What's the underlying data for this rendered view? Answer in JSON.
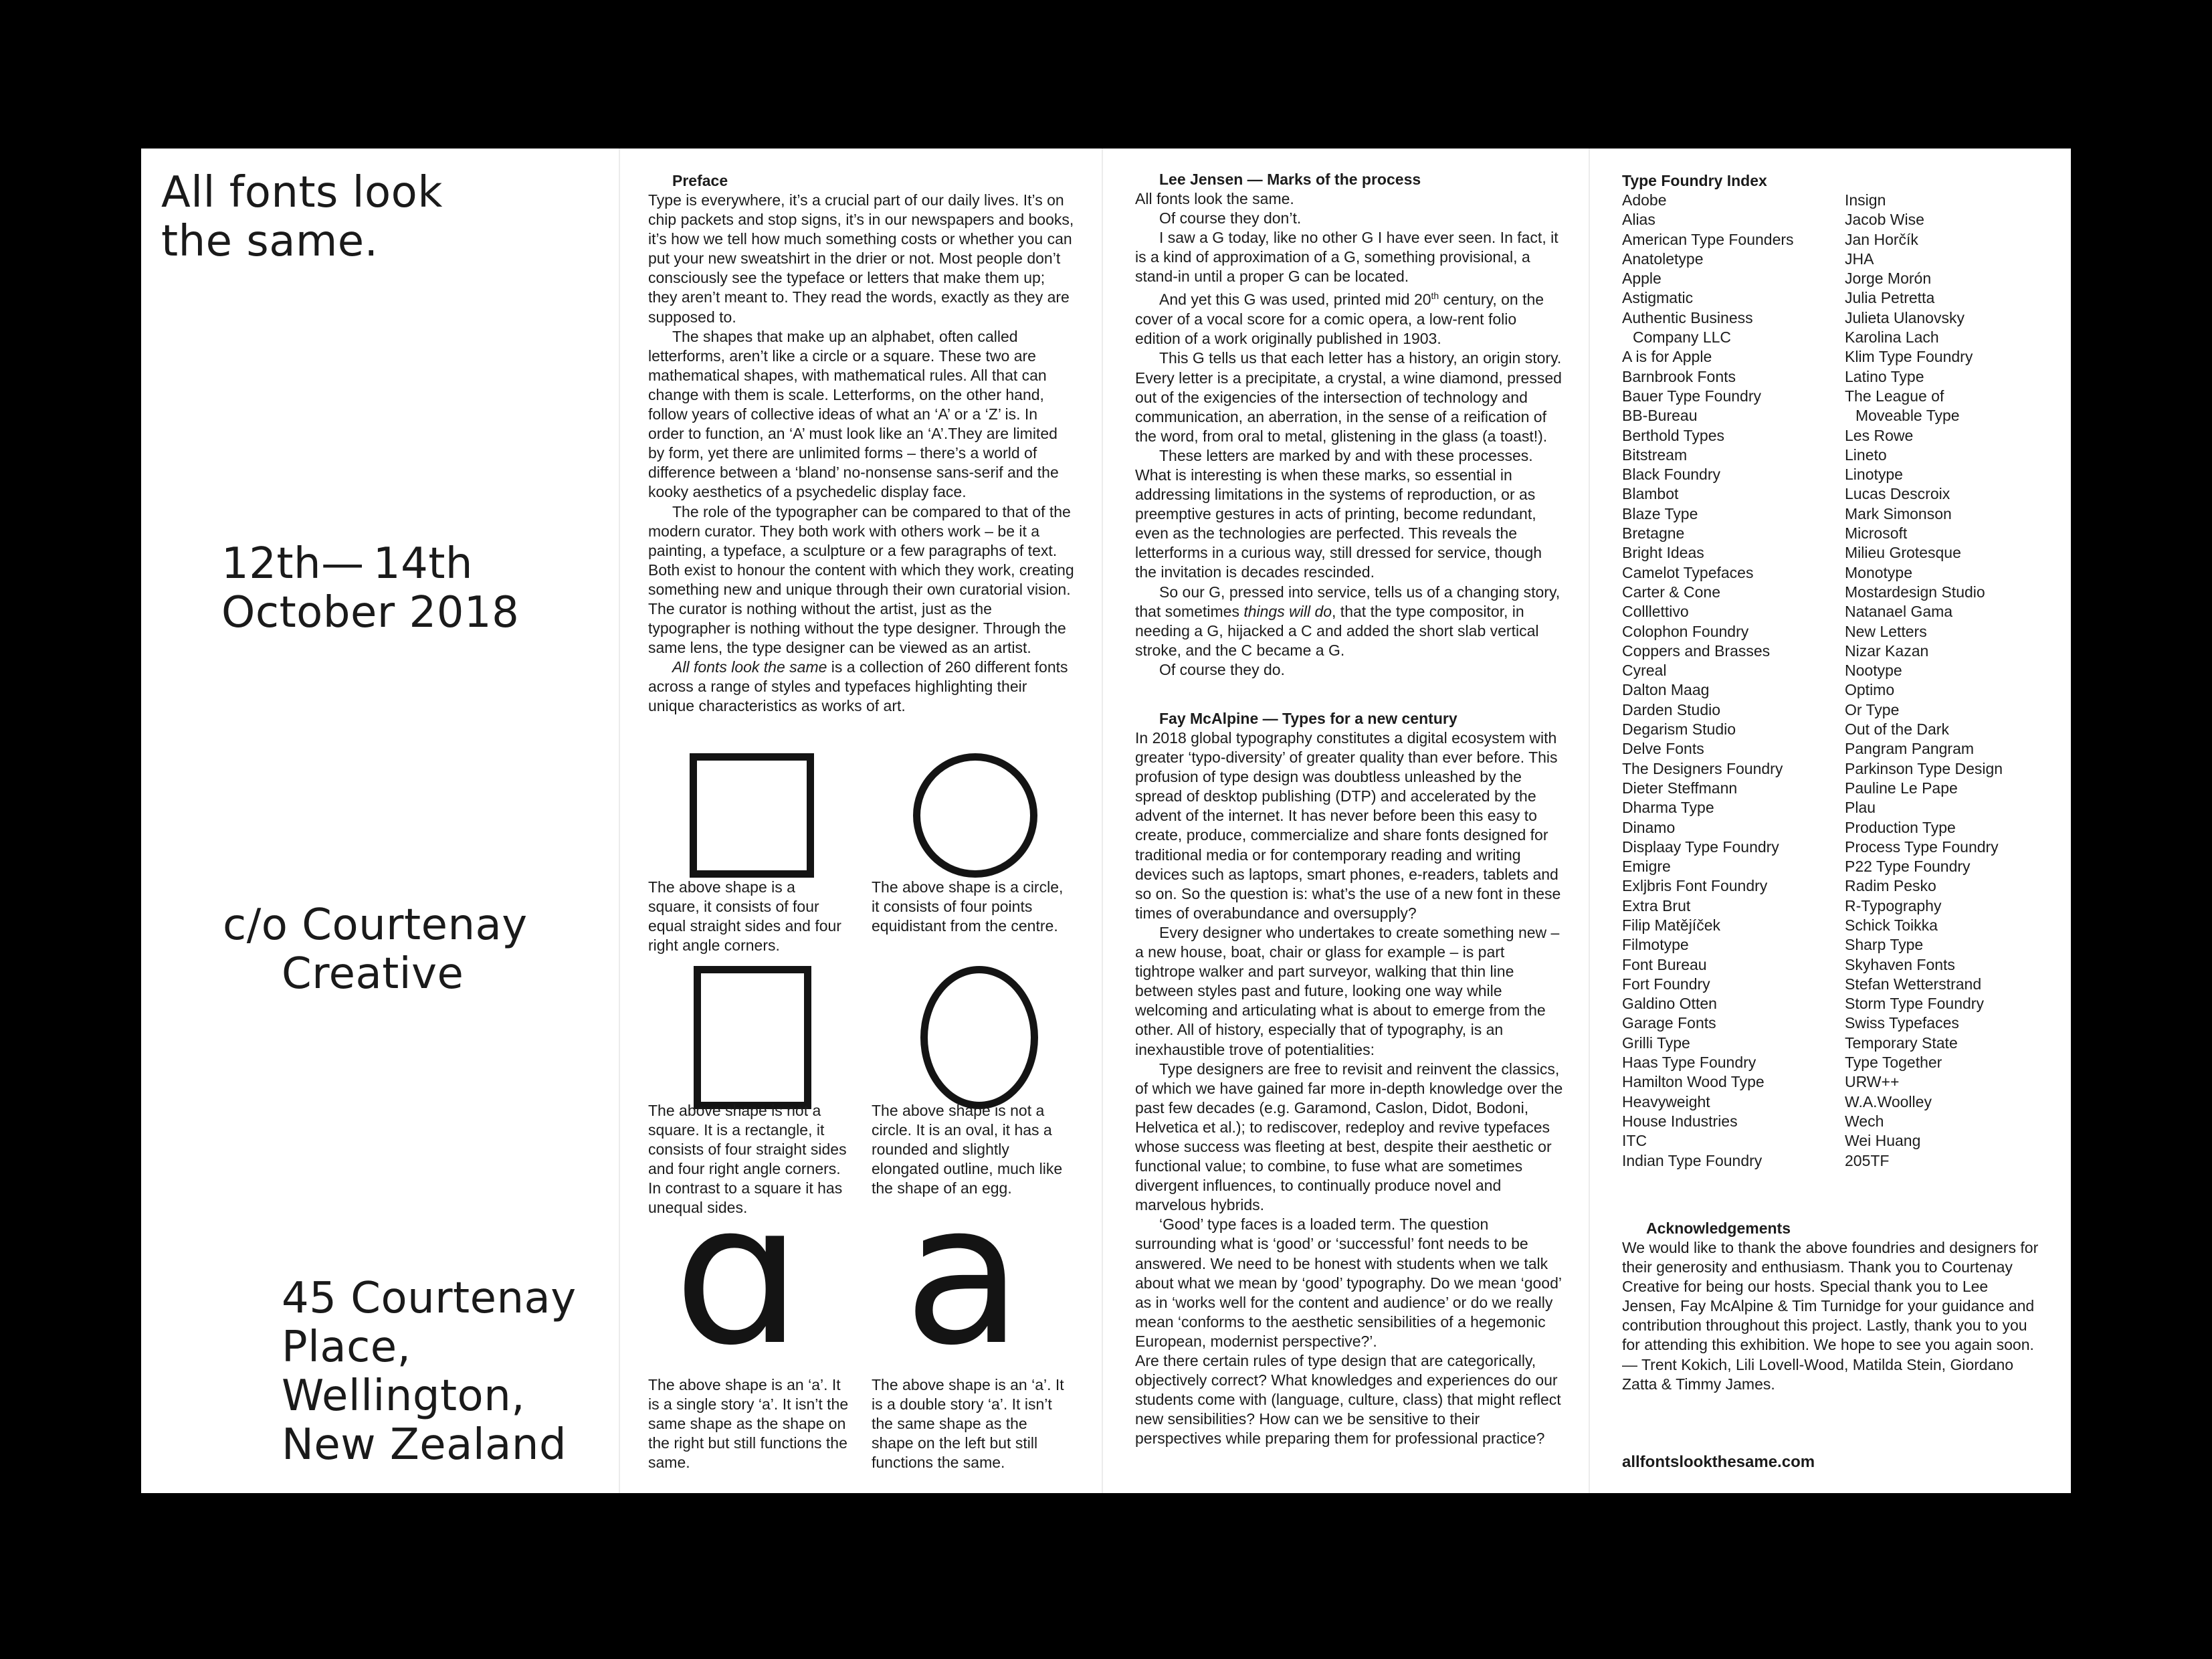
{
  "cover": {
    "title_lines": [
      "All fonts look",
      "the same."
    ],
    "date_lines": [
      "12th— 14th",
      "October 2018"
    ],
    "host_lines": [
      "c/o Courtenay",
      "Creative"
    ],
    "address_lines": [
      "45 Courtenay",
      "Place,",
      "Wellington,",
      "New Zealand"
    ]
  },
  "preface": {
    "heading": "Preface",
    "paragraphs": [
      "Type is everywhere, it’s a crucial part of our daily lives. It’s on chip packets and stop signs, it’s in our newspapers and books, it’s how we tell how much something costs or whether you can put your new sweatshirt in the drier or not. Most people don’t consciously see the typeface or letters that make them up; they aren’t meant to. They read the words, exactly as they are supposed to.",
      "The shapes that make up an alphabet, often called letterforms, aren’t like a circle or a square. These two are mathematical shapes, with mathematical rules. All that can change with them is scale. Letterforms, on the other hand, follow years of collective ideas of what an ‘A’ or a ‘Z’ is. In order to function, an ‘A’ must look like an ‘A’.They are limited by form, yet there are unlimited forms – there’s a world of difference between a ‘bland’ no-nonsense sans-serif and the kooky aesthetics of a psychedelic display face.",
      "The role of the typographer can be compared to that of the modern curator. They both work with others work – be it a painting, a typeface, a sculpture or a few paragraphs of text. Both exist to honour the content with which they work, creating something new and unique through their own curatorial vision. The curator is nothing without the artist, just as the typographer is nothing without the type designer. Through the same lens, the type designer can be viewed as an artist."
    ],
    "closing_em": "All fonts look the same",
    "closing_rest": " is a collection of 260 different fonts across a range of styles and typefaces highlighting their unique characteristics as works of art."
  },
  "shapes": {
    "square_caption": "The above shape is a square, it consists of four equal straight sides and four right angle corners.",
    "circle_caption": "The above shape is a circle, it consists of four points equidistant from the centre.",
    "rect_caption": "The above shape is not a square. It is a rectangle, it consists of four straight sides and four right angle corners. In contrast to a square it has unequal sides.",
    "oval_caption": "The above shape is not a circle. It is an oval, it has a rounded and slightly elongated outline, much like the shape of an egg.",
    "glyph_single": "ɑ",
    "glyph_double": "a",
    "single_a_caption": "The above shape is an ‘a’. It is a single story ‘a’. It isn’t the same shape as the shape on the right but still functions the same.",
    "double_a_caption": "The above shape is an ‘a’. It is a double story ‘a’. It isn’t the same shape as the shape on the left but still functions the same."
  },
  "lee": {
    "heading": "Lee Jensen — Marks of the process",
    "p1": "All fonts look the same.",
    "p2": "Of course they don’t.",
    "p3": "I saw a G today, like no other G I have ever seen. In fact, it is a kind of approximation of a G, something provisional, a stand-in until a proper G can be located.",
    "p4_a": "And yet this G was used, printed mid 20",
    "p4_sup": "th",
    "p4_b": " century, on the cover of a vocal score for a comic opera, a low-rent folio edition of a work originally published in 1903.",
    "p5": "This G tells us that each letter has a history, an origin story. Every letter is a precipitate, a crystal, a wine diamond, pressed out of the exigencies of the intersection of technology and communication, an aberration, in the sense of a reification of the word, from oral to metal, glistening in the glass (a toast!).",
    "p6": "These letters are marked by and with these processes. What is interesting is when these marks, so essential in addressing limitations in the systems of reproduction, or as preemptive gestures in acts of printing, become redundant, even as the technologies are perfected. This reveals the letterforms in a curious way, still dressed for service, though the invitation is decades rescinded.",
    "p7_a": "So our G, pressed into service, tells us of a changing story, that sometimes ",
    "p7_em": "things will do",
    "p7_b": ", that the type compositor, in needing a G, hijacked a C and added the short slab vertical stroke, and the C became a G.",
    "p8": "Of course they do."
  },
  "fay": {
    "heading": "Fay McAlpine — Types for a new century",
    "paragraphs": [
      "In 2018 global typography constitutes a digital ecosystem with greater ‘typo-diversity’ of greater quality than ever before. This profusion of type design was doubtless unleashed by the spread of desktop publishing (DTP) and accelerated by the advent of the internet. It has never before been this easy to create, produce, commercialize and share fonts designed for traditional media or for contemporary reading and writing devices such as laptops, smart phones, e-readers, tablets and so on. So the question is: what’s the use of a new font in these times of overabundance and oversupply?",
      "Every designer who undertakes to create something new – a new house, boat, chair or glass for example – is part tightrope walker and part surveyor, walking that thin line between styles past and future, looking one way while welcoming and articulating what is about to emerge from the other. All of history, especially that of typography, is an inexhaustible trove of potentialities:",
      "Type designers are free to revisit and reinvent the classics, of which we have gained far more in-depth knowledge over the past few decades (e.g. Garamond, Caslon, Didot, Bodoni, Helvetica et al.); to rediscover, redeploy and revive typefaces whose success was fleeting at best, despite their aesthetic or functional value; to combine, to fuse what are sometimes divergent influences, to continually produce novel and marvelous hybrids.",
      "‘Good’ type faces is a loaded term. The question surrounding what is ‘good’ or ‘successful’ font needs to be answered. We need to be honest with students when we talk about what we mean by ‘good’ typography. Do we mean ‘good’ as in ‘works well for the content and audience’ or do we really mean ‘conforms to the aesthetic sensibilities of a hegemonic European, modernist perspective?’.",
      "Are there certain rules of type design that are categorically, objectively correct? What knowledges and experiences do our students come with (language, culture, class) that might reflect new sensibilities? How can we be sensitive to their perspectives while preparing them for professional practice?"
    ]
  },
  "index": {
    "heading": "Type Foundry Index",
    "col1": [
      "Adobe",
      "Alias",
      "American Type Founders",
      "Anatoletype",
      "Apple",
      "Astigmatic",
      "Authentic Business",
      "Company LLC",
      "A is for Apple",
      "Barnbrook Fonts",
      "Bauer Type Foundry",
      "BB-Bureau",
      "Berthold Types",
      "Bitstream",
      "Black Foundry",
      "Blambot",
      "Blaze Type",
      "Bretagne",
      "Bright Ideas",
      "Camelot Typefaces",
      "Carter & Cone",
      "Colllettivo",
      "Colophon Foundry",
      "Coppers and Brasses",
      "Cyreal",
      "Dalton Maag",
      "Darden Studio",
      "Degarism Studio",
      "Delve Fonts",
      "The Designers Foundry",
      "Dieter Steffmann",
      "Dharma Type",
      "Dinamo",
      "Displaay Type Foundry",
      "Emigre",
      "Exljbris Font Foundry",
      "Extra Brut",
      "Filip Matějíček",
      "Filmotype",
      "Font Bureau",
      "Fort Foundry",
      "Galdino Otten",
      "Garage Fonts",
      "Grilli Type",
      "Haas Type Foundry",
      "Hamilton Wood Type",
      "Heavyweight",
      "House Industries",
      "ITC",
      "Indian Type Foundry"
    ],
    "col2": [
      "Insign",
      "Jacob Wise",
      "Jan Horčík",
      "JHA",
      "Jorge Morón",
      "Julia Petretta",
      "Julieta Ulanovsky",
      "Karolina Lach",
      "Klim Type Foundry",
      "Latino Type",
      "The League of",
      "Moveable Type",
      "Les Rowe",
      "Lineto",
      "Linotype",
      "Lucas Descroix",
      "Mark Simonson",
      "Microsoft",
      "Milieu Grotesque",
      "Monotype",
      "Mostardesign Studio",
      "Natanael Gama",
      "New Letters",
      "Nizar Kazan",
      "Nootype",
      "Optimo",
      "Or Type",
      "Out of the Dark",
      "Pangram Pangram",
      "Parkinson Type Design",
      "Pauline Le Pape",
      "Plau",
      "Production Type",
      "Process Type Foundry",
      "P22 Type Foundry",
      "Radim Pesko",
      "R-Typography",
      "Schick Toikka",
      "Sharp Type",
      "Skyhaven Fonts",
      "Stefan Wetterstrand",
      "Storm Type Foundry",
      "Swiss Typefaces",
      "Temporary State",
      "Type Together",
      "URW++",
      "W.A.Woolley",
      "Wech",
      "Wei Huang",
      "205TF"
    ]
  },
  "ack": {
    "heading": "Acknowledgements",
    "text": "We would like to thank the above foundries and designers for their generosity and enthusiasm. Thank you to Courtenay Creative for being our hosts. Special thank you to Lee Jensen, Fay McAlpine & Tim Turnidge for your guidance and contribution throughout this project. Lastly, thank you to you for attending this exhibition. We hope to see you again soon.",
    "signoff": "— Trent Kokich, Lili Lovell-Wood, Matilda Stein, Giordano Zatta & Timmy James."
  },
  "website": "allfontslookthesame.com"
}
